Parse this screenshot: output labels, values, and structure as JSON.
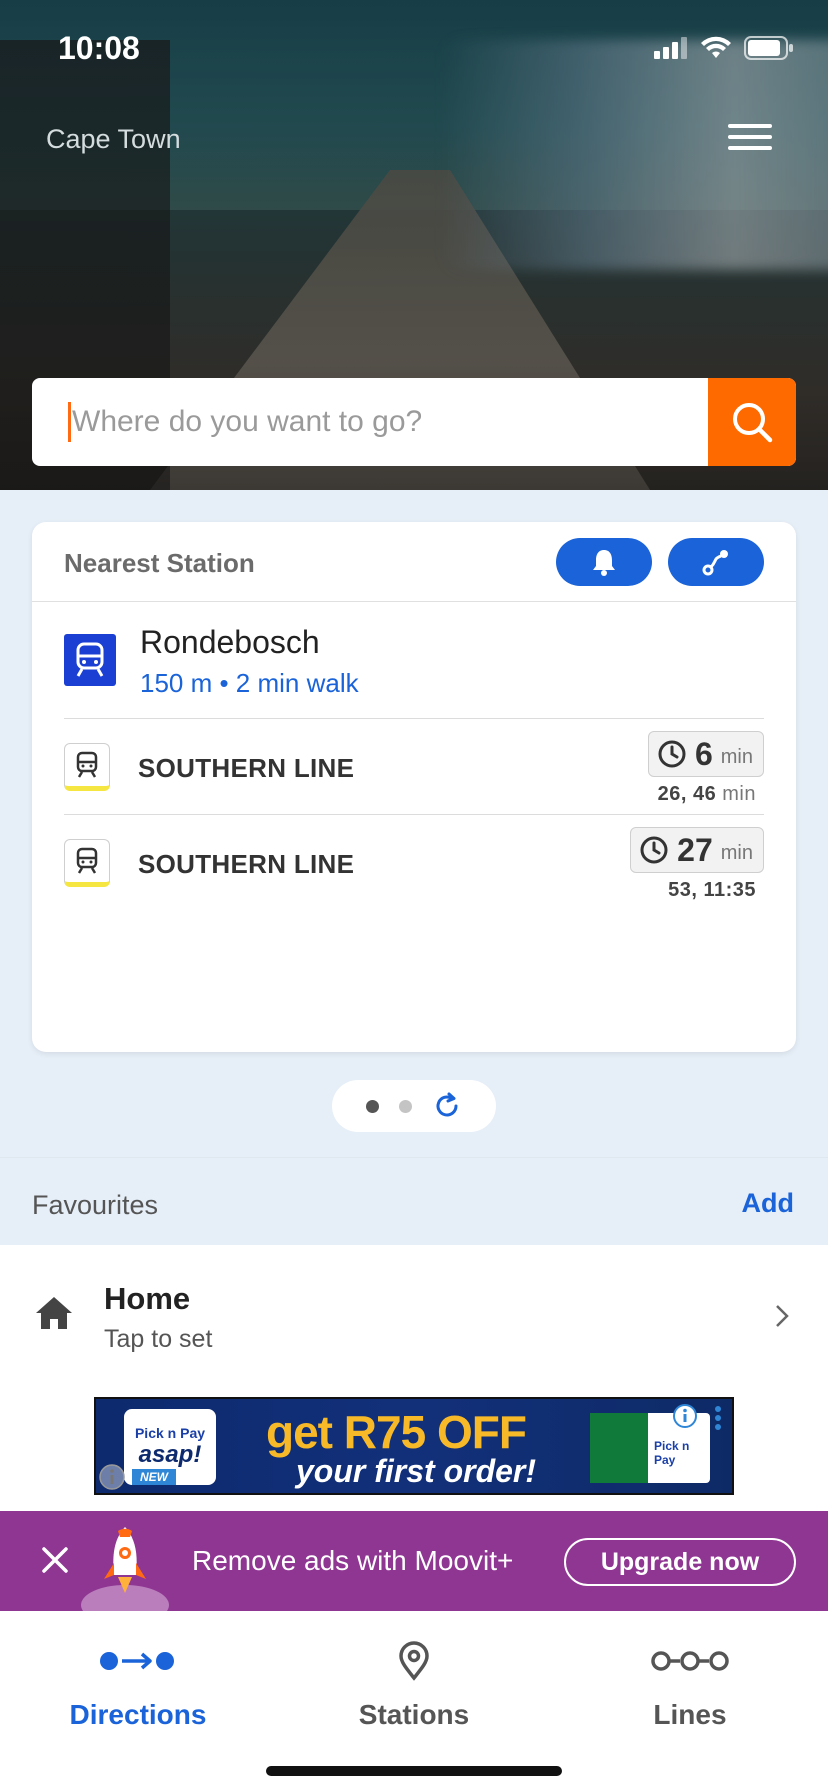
{
  "status_bar": {
    "time": "10:08"
  },
  "header": {
    "city": "Cape Town"
  },
  "search": {
    "placeholder": "Where do you want to go?"
  },
  "nearest_station": {
    "title": "Nearest Station",
    "station_name": "Rondebosch",
    "distance": "150 m • 2 min walk",
    "lines": [
      {
        "name": "SOUTHERN LINE",
        "eta": "6",
        "eta_unit": "min",
        "next": "26, 46",
        "next_unit": "min",
        "line_color": "#f5e642"
      },
      {
        "name": "SOUTHERN LINE",
        "eta": "27",
        "eta_unit": "min",
        "next": "53, 11:35",
        "next_unit": "",
        "line_color": "#f5e642"
      }
    ]
  },
  "favourites": {
    "title": "Favourites",
    "add_label": "Add",
    "items": [
      {
        "label": "Home",
        "subtitle": "Tap to set"
      }
    ]
  },
  "ad": {
    "brand_top": "Pick n Pay",
    "brand_main": "asap!",
    "tag": "NEW",
    "headline": "get R75 OFF",
    "subline": "your first order!"
  },
  "promo": {
    "text": "Remove ads with Moovit+",
    "button": "Upgrade now"
  },
  "tabs": [
    {
      "label": "Directions",
      "icon": "directions-icon",
      "active": true
    },
    {
      "label": "Stations",
      "icon": "location-pin-icon",
      "active": false
    },
    {
      "label": "Lines",
      "icon": "lines-icon",
      "active": false
    }
  ],
  "colors": {
    "accent": "#1a63d8",
    "search_button": "#ff6a00",
    "promo_bg": "#8f3692",
    "station_icon": "#1a3fd2"
  }
}
